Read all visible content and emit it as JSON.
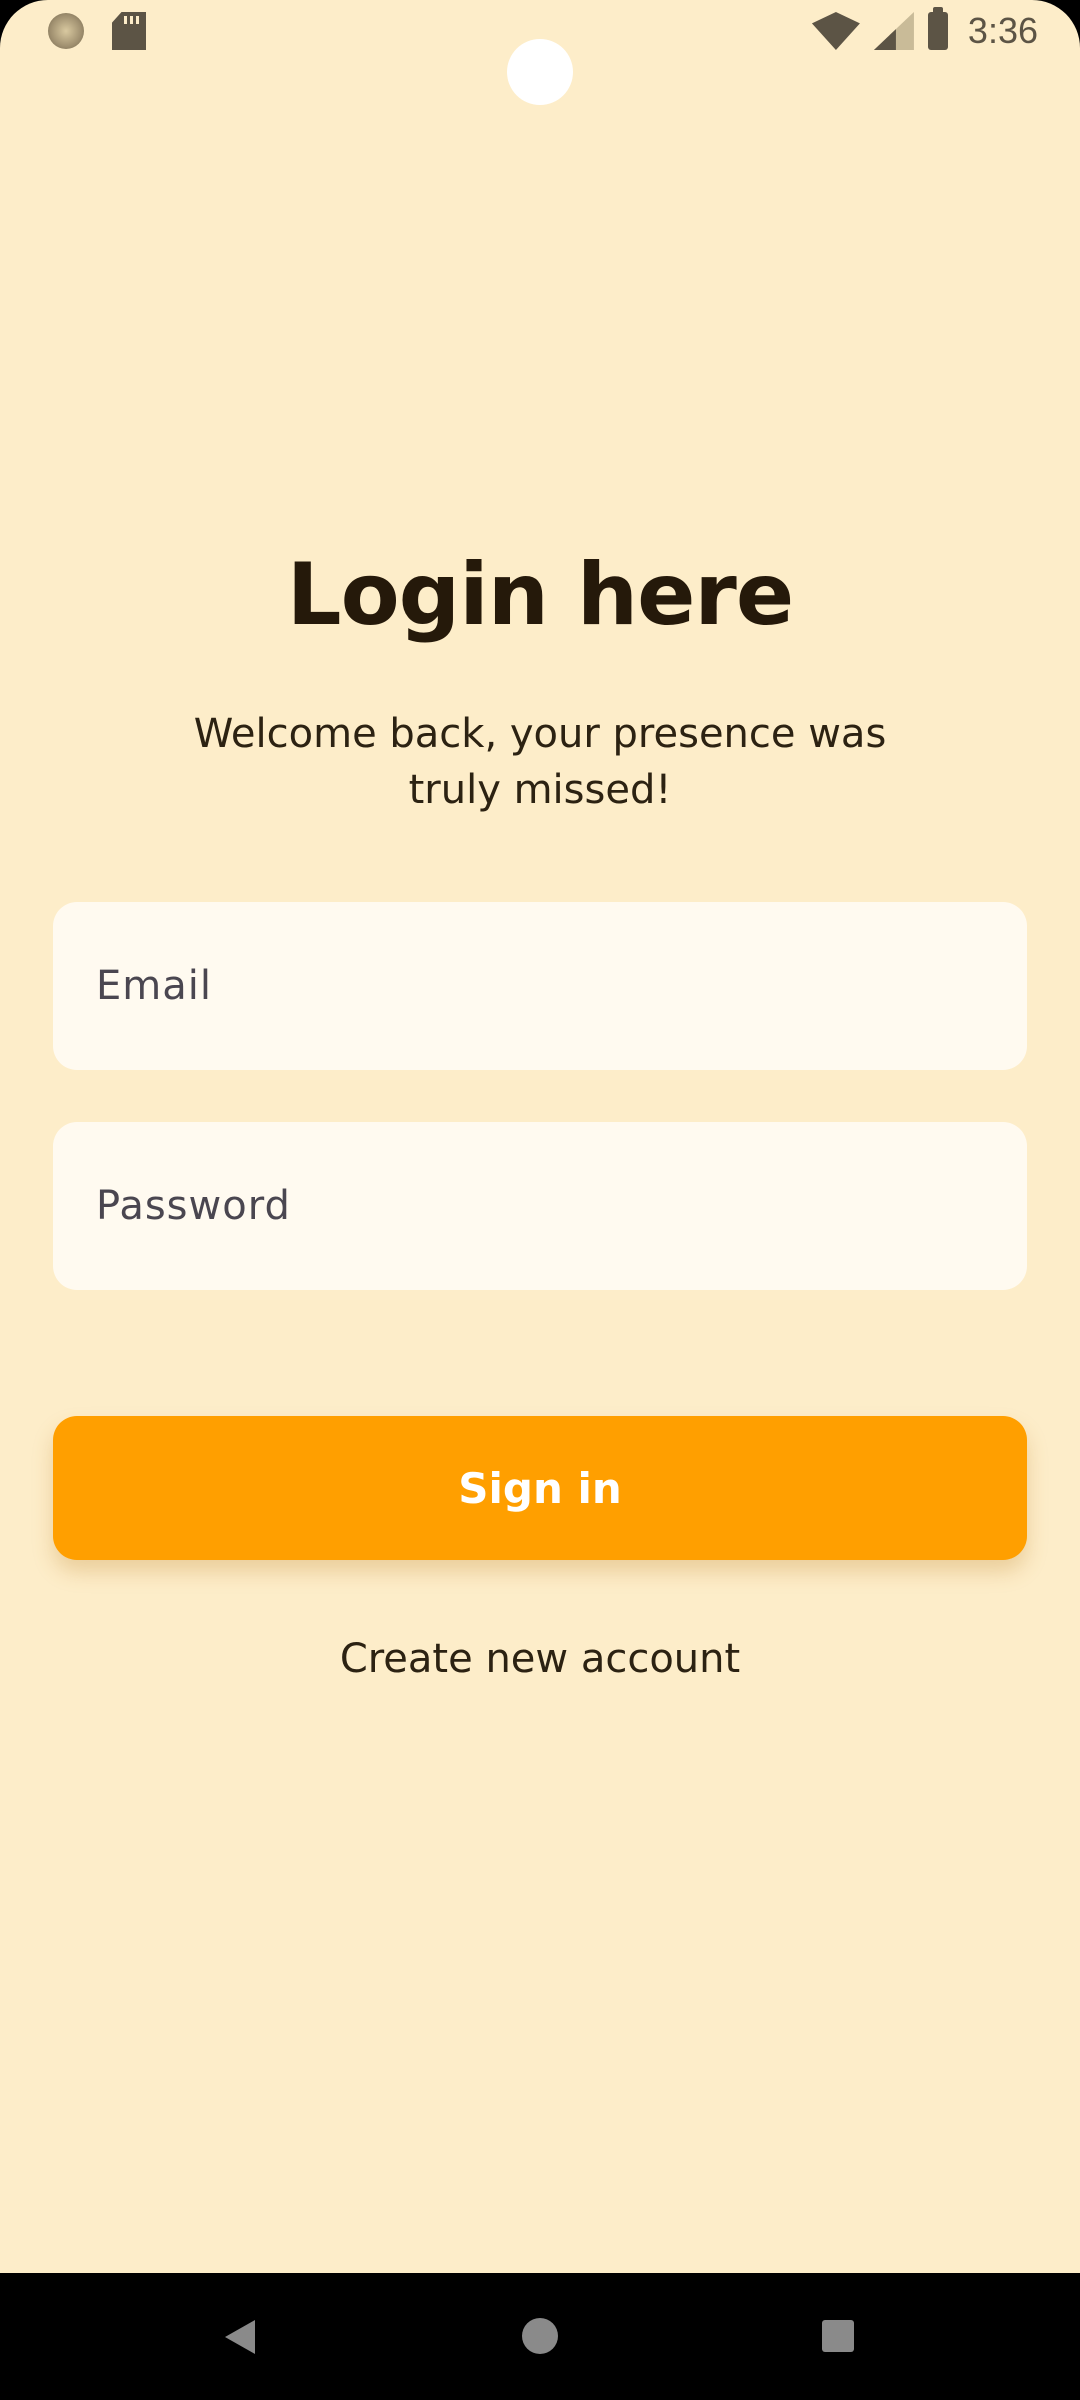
{
  "status_bar": {
    "time": "3:36",
    "icons": [
      "system-circle-icon",
      "sd-card-icon",
      "wifi-icon",
      "signal-icon",
      "battery-icon"
    ]
  },
  "login": {
    "title": "Login here",
    "subtitle": "Welcome back, your presence was truly missed!",
    "email_placeholder": "Email",
    "password_placeholder": "Password",
    "sign_in_label": "Sign in",
    "create_account_label": "Create new account"
  },
  "colors": {
    "background": "#fdedc9",
    "accent": "#ff9f00",
    "field_background": "#fffaf0",
    "title_text": "#25190a"
  },
  "nav_bar": {
    "buttons": [
      "back-icon",
      "home-icon",
      "recents-icon"
    ]
  }
}
